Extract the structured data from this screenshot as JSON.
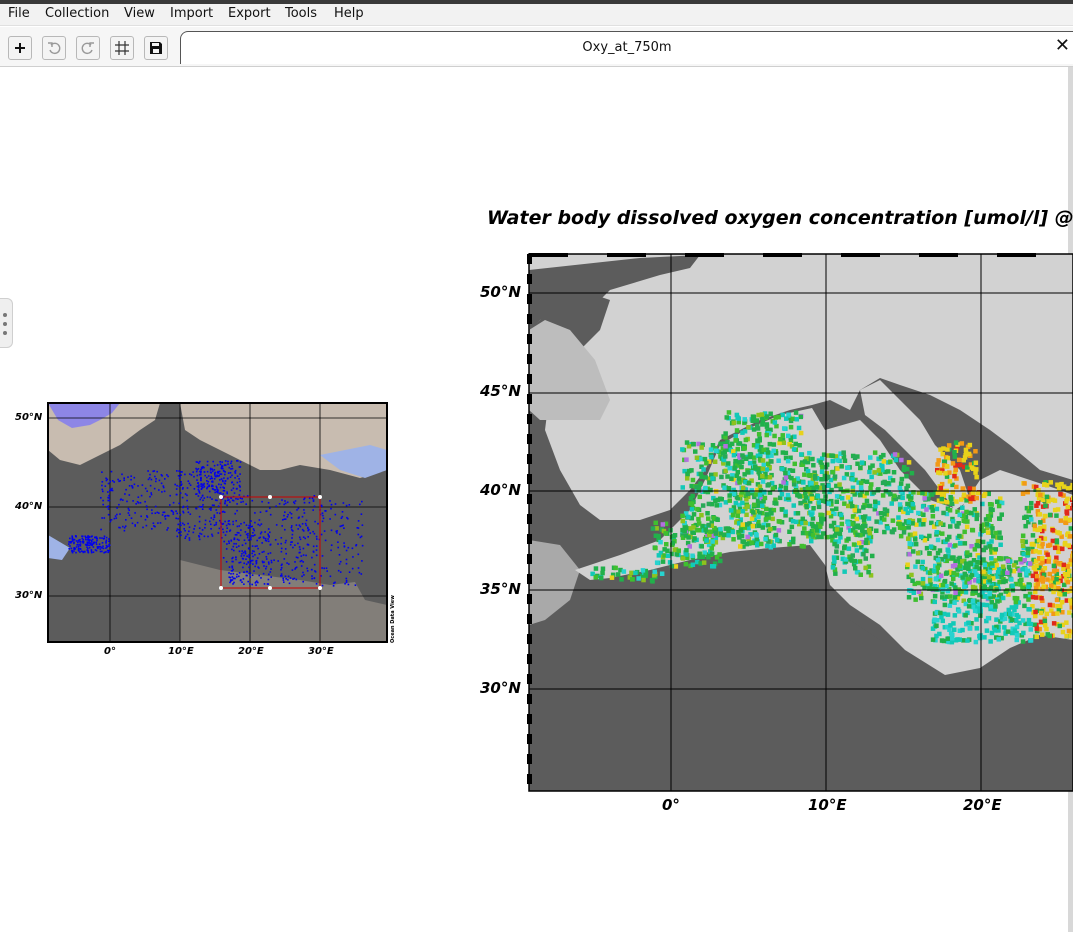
{
  "menubar": {
    "items": [
      "File",
      "Collection",
      "View",
      "Import",
      "Export",
      "Tools",
      "Help"
    ]
  },
  "toolbar": {
    "buttons": [
      {
        "name": "add-button",
        "icon": "plus-icon"
      },
      {
        "name": "undo-button",
        "icon": "undo-icon"
      },
      {
        "name": "redo-button",
        "icon": "redo-icon"
      },
      {
        "name": "grid-button",
        "icon": "grid-icon"
      },
      {
        "name": "save-button",
        "icon": "save-icon"
      }
    ]
  },
  "tab": {
    "title": "Oxy_at_750m",
    "close_label": "✕"
  },
  "overview_map": {
    "lat_labels": [
      "50°N",
      "40°N",
      "30°N"
    ],
    "lon_labels": [
      "0°",
      "10°E",
      "20°E",
      "30°E"
    ],
    "credit": "Ocean Data View",
    "point_color": "#0000ee",
    "selection_color": "#cc0000"
  },
  "main_map": {
    "title": "Water body dissolved oxygen concentration [umol/l] @",
    "lat_labels": [
      "50°N",
      "45°N",
      "40°N",
      "35°N",
      "30°N"
    ],
    "lon_labels": [
      "0°",
      "10°E",
      "20°E"
    ],
    "colors": {
      "ocean": "#5c5c5c",
      "land": "#d2d2d2",
      "grid": "#000000"
    }
  }
}
